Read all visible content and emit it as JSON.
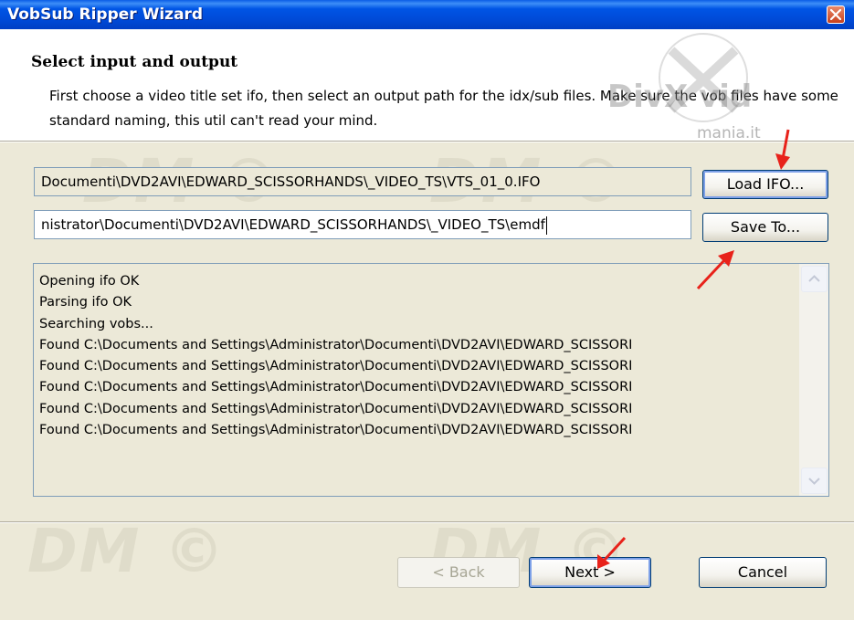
{
  "window": {
    "title": "VobSub Ripper Wizard",
    "close_icon": "close-icon"
  },
  "header": {
    "title": "Select input and output",
    "description": "First choose a video title set ifo, then select an output path for the idx/sub files. Make sure the vob files have some standard naming, this util can't read your mind.",
    "logo_text": "DivX vid",
    "logo_subtext": "mania.it"
  },
  "input_ifo": {
    "value": "Documenti\\DVD2AVI\\EDWARD_SCISSORHANDS\\_VIDEO_TS\\VTS_01_0.IFO",
    "button_label": "Load IFO..."
  },
  "output_path": {
    "value": "nistrator\\Documenti\\DVD2AVI\\EDWARD_SCISSORHANDS\\_VIDEO_TS\\emdf",
    "button_label": "Save To..."
  },
  "log": {
    "lines": [
      "Opening ifo OK",
      "Parsing ifo OK",
      "Searching vobs...",
      "Found C:\\Documents and Settings\\Administrator\\Documenti\\DVD2AVI\\EDWARD_SCISSORI",
      "Found C:\\Documents and Settings\\Administrator\\Documenti\\DVD2AVI\\EDWARD_SCISSORI",
      "Found C:\\Documents and Settings\\Administrator\\Documenti\\DVD2AVI\\EDWARD_SCISSORI",
      "Found C:\\Documents and Settings\\Administrator\\Documenti\\DVD2AVI\\EDWARD_SCISSORI",
      "Found C:\\Documents and Settings\\Administrator\\Documenti\\DVD2AVI\\EDWARD_SCISSORI"
    ]
  },
  "watermark": "DM ©",
  "footer": {
    "back_label": "< Back",
    "next_label": "Next >",
    "cancel_label": "Cancel"
  },
  "colors": {
    "titlebar": "#0055e5",
    "dialog_bg": "#ece9d8",
    "annotation_arrow": "#e8221a"
  }
}
